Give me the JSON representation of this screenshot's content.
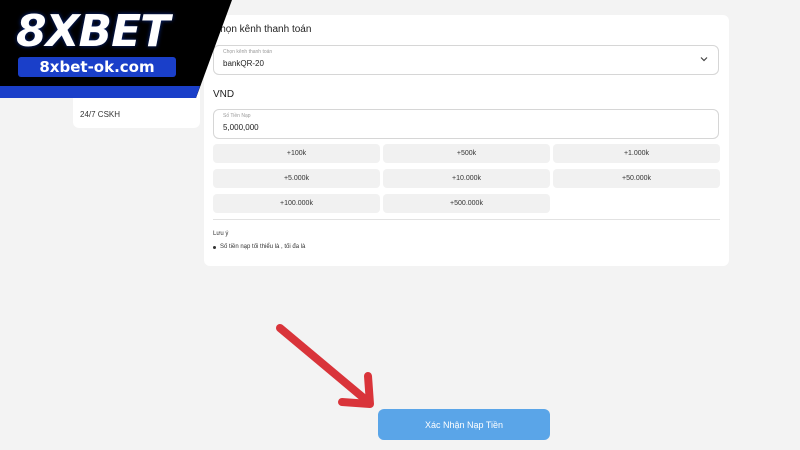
{
  "brand": {
    "logo_text": "8XBET",
    "logo_url": "8xbet-ok.com"
  },
  "sidebar": {
    "items": [
      {
        "label": "24/7 CSKH"
      }
    ]
  },
  "payment": {
    "channel_title": "Chọn kênh thanh toán",
    "channel_field": {
      "label": "Chọn kênh thanh toán",
      "value": "bankQR-20"
    },
    "currency_title": "VND",
    "amount_field": {
      "label": "Số Tiền Nạp",
      "value": "5,000,000"
    },
    "quick_amounts": [
      "+100k",
      "+500k",
      "+1.000k",
      "+5.000k",
      "+10.000k",
      "+50.000k",
      "+100.000k",
      "+500.000k"
    ],
    "note_title": "Lưu ý",
    "notes": [
      "Số tiền nạp tối thiểu là , tối đa là"
    ],
    "confirm_label": "Xác Nhận Nạp Tiền"
  },
  "colors": {
    "accent": "#5aa5e8",
    "arrow": "#d9343a",
    "logo_bg": "#000000",
    "logo_stripe": "#1a3fc9"
  }
}
